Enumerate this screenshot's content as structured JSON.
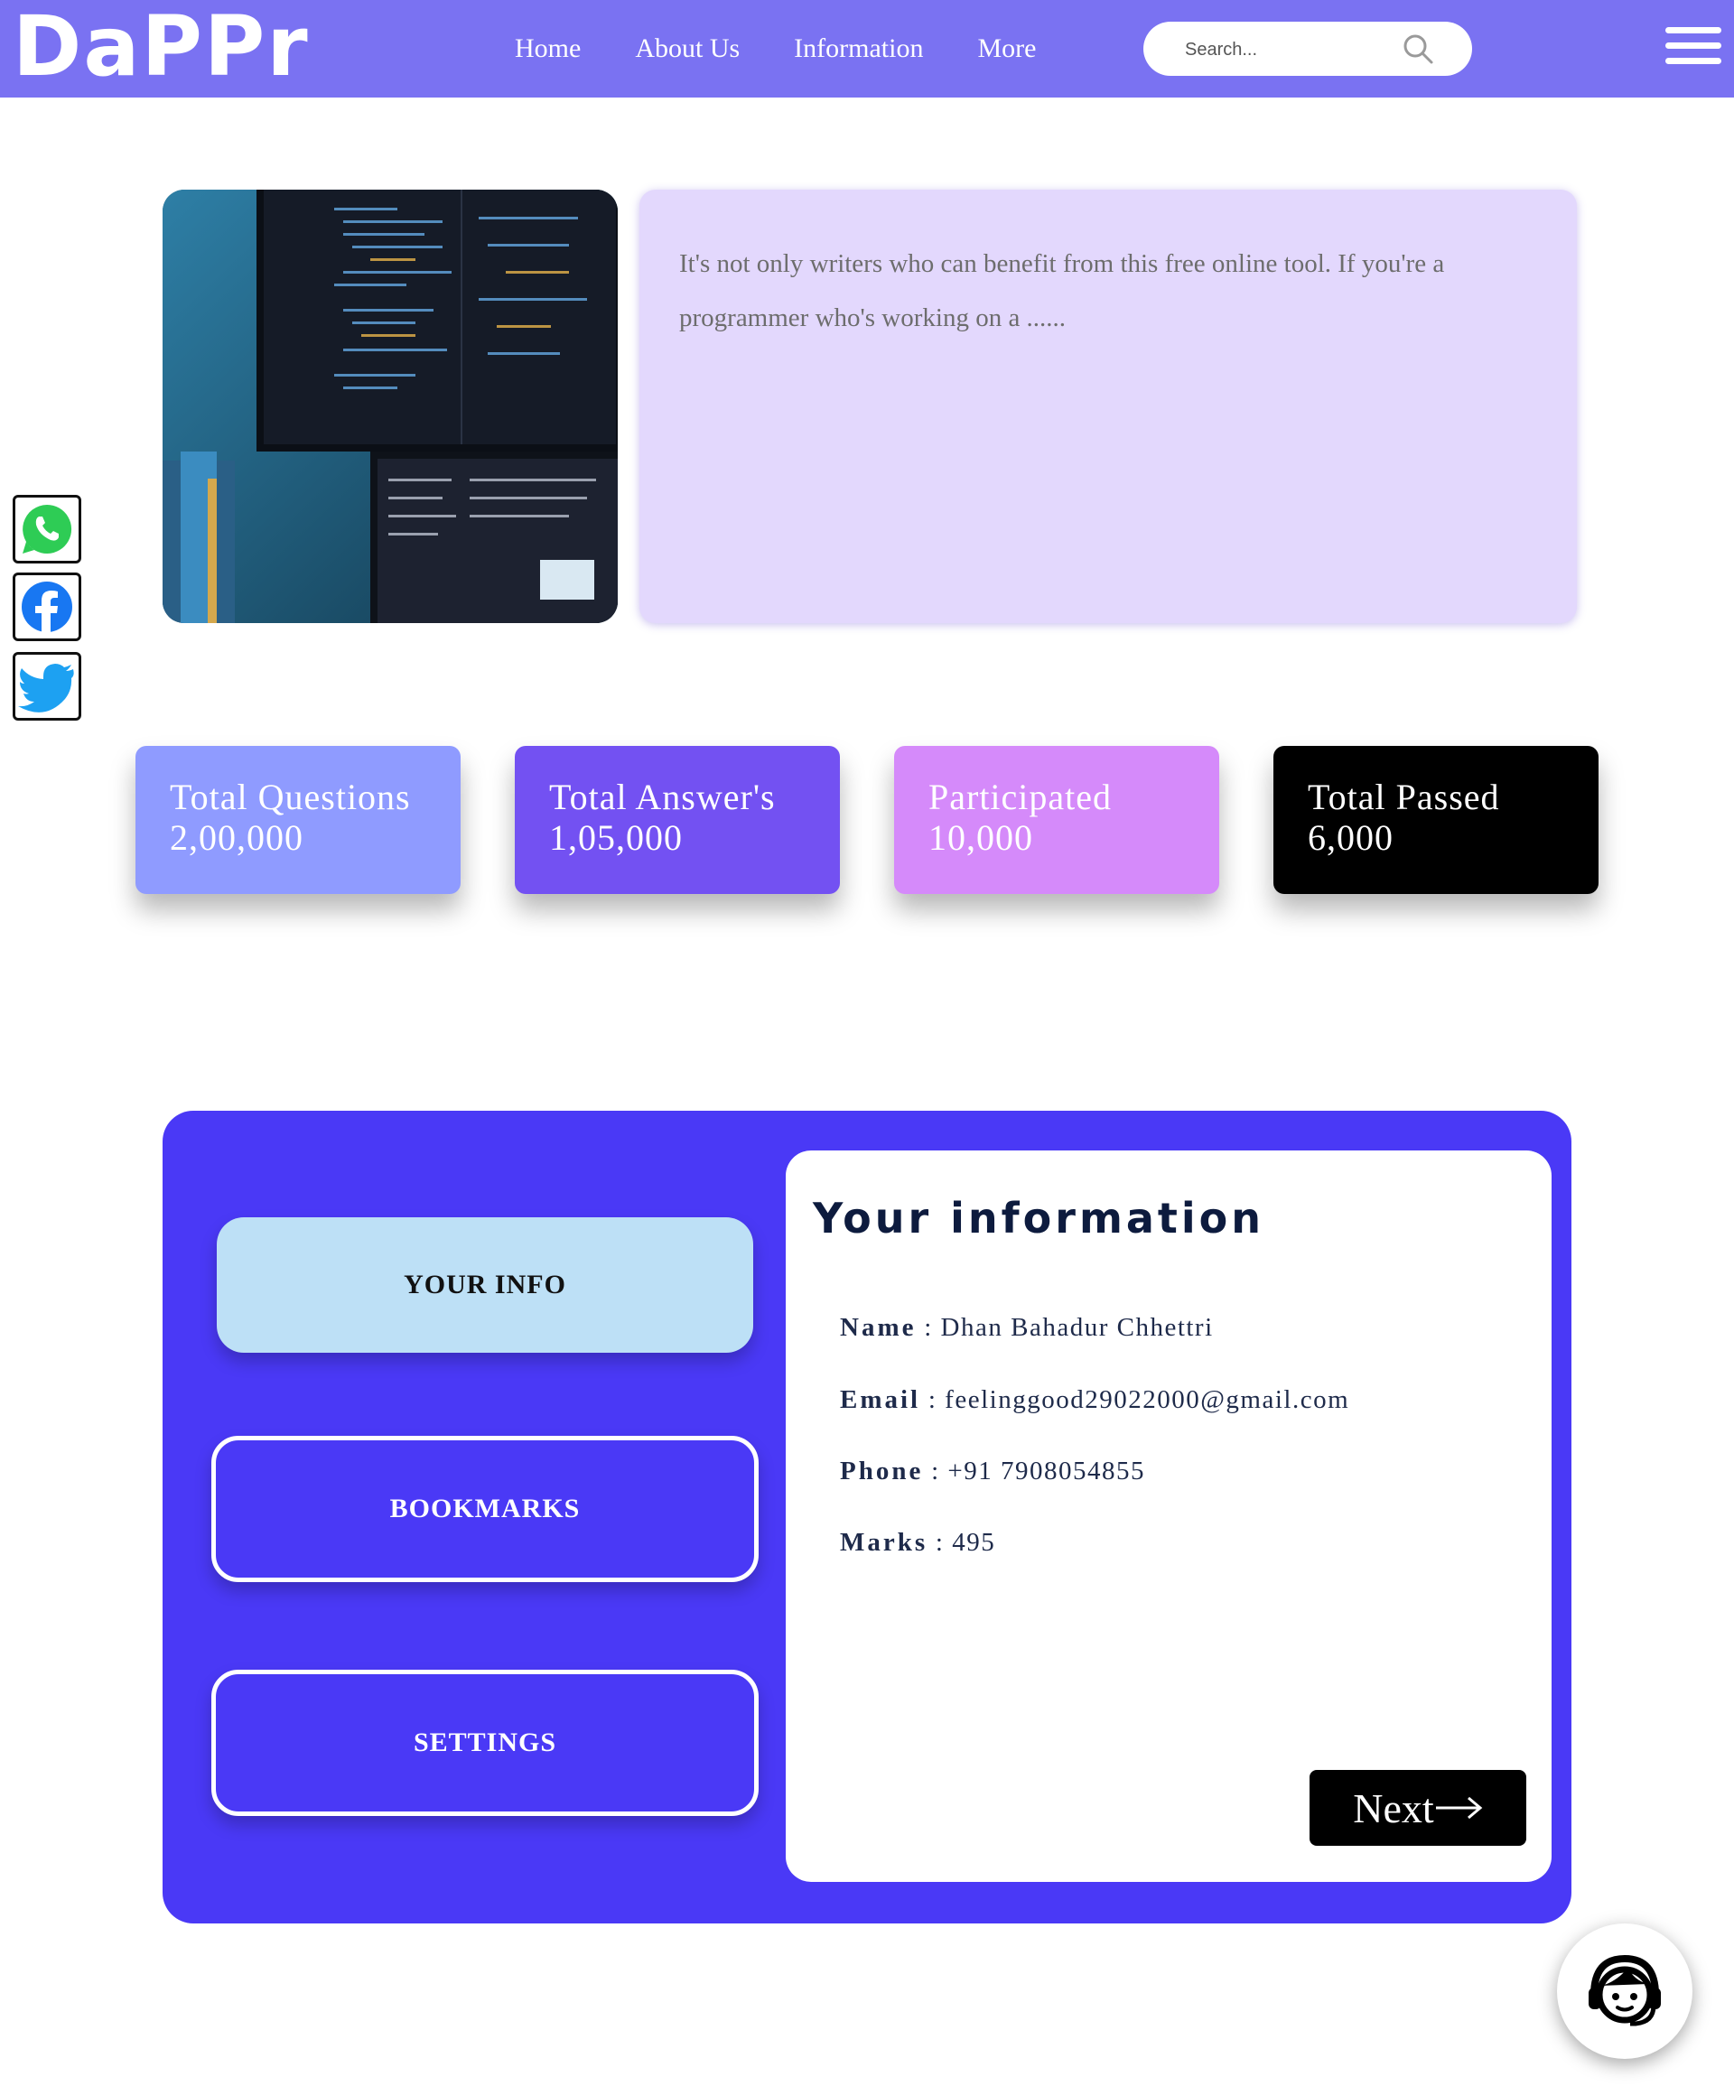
{
  "brand": {
    "logo_text": "DaPPr"
  },
  "nav": {
    "items": [
      {
        "label": "Home"
      },
      {
        "label": "About Us"
      },
      {
        "label": "Information"
      },
      {
        "label": "More"
      }
    ],
    "search": {
      "placeholder": "Search..."
    }
  },
  "social": {
    "icons": [
      "whatsapp-icon",
      "facebook-icon",
      "twitter-icon"
    ]
  },
  "hero": {
    "image": "code-on-monitors-photo",
    "text": "It's not only writers who can benefit from this free online tool. If you're a programmer who's working on a ......"
  },
  "stats": [
    {
      "label": "Total Questions",
      "value": "2,00,000",
      "color": "#8f9bff"
    },
    {
      "label": "Total Answer's",
      "value": "1,05,000",
      "color": "#7351f2"
    },
    {
      "label": "Participated",
      "value": "10,000",
      "color": "#d58afa"
    },
    {
      "label": "Total Passed",
      "value": "6,000",
      "color": "#000000"
    }
  ],
  "profile": {
    "tabs": [
      {
        "label": "YOUR INFO",
        "active": true
      },
      {
        "label": "BOOKMARKS",
        "active": false
      },
      {
        "label": "SETTINGS",
        "active": false
      }
    ],
    "title": "Your information",
    "fields": [
      {
        "key": "Name",
        "value": ": Dhan Bahadur Chhettri"
      },
      {
        "key": "Email",
        "value": ": feelinggood29022000@gmail.com"
      },
      {
        "key": "Phone",
        "value": ": +91 7908054855"
      },
      {
        "key": "Marks",
        "value": ": 495"
      }
    ],
    "next_label": "Next"
  },
  "support": {
    "icon": "support-agent-icon"
  },
  "colors": {
    "navbar": "#7a72f2",
    "panel": "#4a39f6",
    "hero_text_bg": "#e3d8fd",
    "active_tab": "#bde0f6"
  }
}
